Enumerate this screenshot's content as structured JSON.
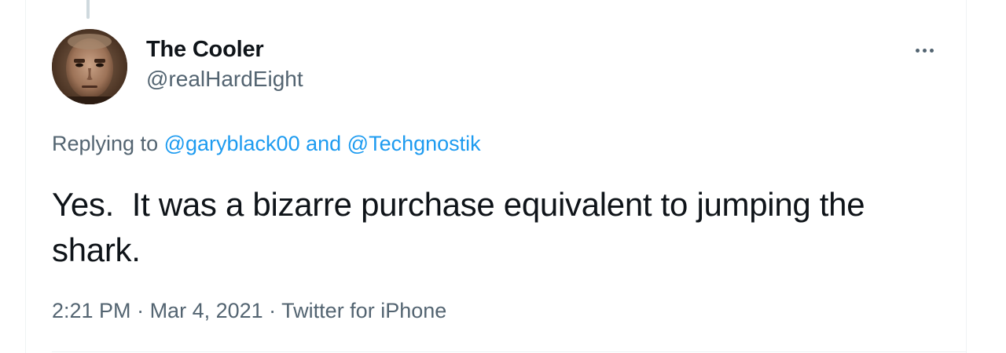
{
  "tweet": {
    "author": {
      "display_name": "The Cooler",
      "handle": "@realHardEight",
      "avatar": "avatar-photo"
    },
    "more_icon": "more-horizontal-icon",
    "replying": {
      "prefix": "Replying to ",
      "mention1": "@garyblack00",
      "joiner": " and ",
      "mention2": "@Techgnostik"
    },
    "text": "Yes.  It was a bizarre purchase equivalent to jumping the shark.",
    "meta": {
      "time": "2:21 PM",
      "separator1": " · ",
      "date": "Mar 4, 2021",
      "separator2": " · ",
      "source": "Twitter for iPhone"
    }
  },
  "colors": {
    "text_primary": "#0f1419",
    "text_secondary": "#536471",
    "link": "#1d9bf0",
    "border": "#eff3f4"
  }
}
